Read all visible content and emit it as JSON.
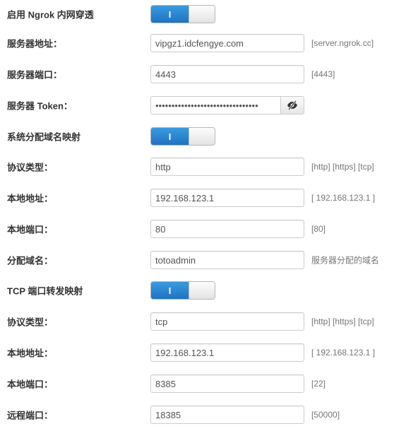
{
  "ngrok_enable": {
    "label": "启用 Ngrok 内网穿透",
    "on_glyph": "I"
  },
  "server_addr": {
    "label": "服务器地址：",
    "value": "vipgz1.idcfengye.com",
    "hint": "[server.ngrok.cc]"
  },
  "server_port": {
    "label": "服务器端口：",
    "value": "4443",
    "hint": "[4443]"
  },
  "server_token": {
    "label": "服务器 Token：",
    "value": "••••••••••••••••••••••••••••••••",
    "reveal_icon": "eye-slash-icon"
  },
  "domain_mapping": {
    "label": "系统分配域名映射",
    "on_glyph": "I"
  },
  "http_protocol": {
    "label": "协议类型：",
    "value": "http",
    "hint": "[http] [https] [tcp]"
  },
  "http_local_addr": {
    "label": "本地地址：",
    "value": "192.168.123.1",
    "hint": "[ 192.168.123.1 ]"
  },
  "http_local_port": {
    "label": "本地端口：",
    "value": "80",
    "hint": "[80]"
  },
  "assigned_domain": {
    "label": "分配域名：",
    "value": "totoadmin",
    "hint": "服务器分配的域名"
  },
  "tcp_forward": {
    "label": "TCP 端口转发映射",
    "on_glyph": "I"
  },
  "tcp_protocol": {
    "label": "协议类型：",
    "value": "tcp",
    "hint": "[http] [https] [tcp]"
  },
  "tcp_local_addr": {
    "label": "本地地址：",
    "value": "192.168.123.1",
    "hint": "[ 192.168.123.1 ]"
  },
  "tcp_local_port": {
    "label": "本地端口：",
    "value": "8385",
    "hint": "[22]"
  },
  "tcp_remote_port": {
    "label": "远程端口：",
    "value": "18385",
    "hint": "[50000]"
  },
  "colors": {
    "accent": "#1f72c2",
    "label": "#333333",
    "hint": "#777777",
    "border": "#cccccc"
  }
}
